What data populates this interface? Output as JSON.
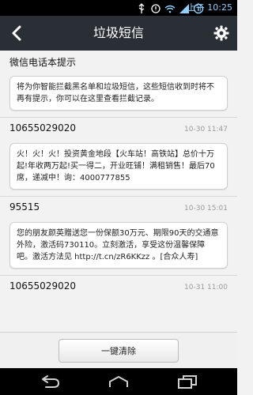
{
  "status_bar": {
    "time": "上午 10:25",
    "icons": [
      "usb-icon",
      "notification-icon",
      "wifi-icon",
      "signal-icon",
      "battery-icon"
    ]
  },
  "titlebar": {
    "title": "垃圾短信",
    "back_icon": "back-chevron-icon",
    "settings_icon": "gear-icon"
  },
  "messages": [
    {
      "sender": "微信电话本提示",
      "time": "",
      "body": "将为你智能拦截黑名单和垃圾短信，这些短信收到时将不再有提示，你可以在这里查看拦截记录。"
    },
    {
      "sender": "10655029020",
      "time": "10-30 11:47",
      "body": "火！火！火！投资黄金地段【火车站！高铁站】总价十万起!年收两万起!买一得二，开业旺铺！满租销售！最后70席，递减中！询：4000777855"
    },
    {
      "sender": "95515",
      "time": "10-30 15:01",
      "body": "您的朋友颜英赠送您一份保额30万元、期限90天的交通意外险，激活码730110。立刻激活，享受这份温馨保障吧。激活方法见 http://t.cn/zR6KKzz 。[合众人寿]"
    },
    {
      "sender": "10655029020",
      "time": "10-31 11:00",
      "body": ""
    }
  ],
  "footer": {
    "clear_button": "一键清除"
  },
  "navbar": {
    "icons": [
      "back-icon",
      "home-icon",
      "recent-apps-icon"
    ]
  }
}
